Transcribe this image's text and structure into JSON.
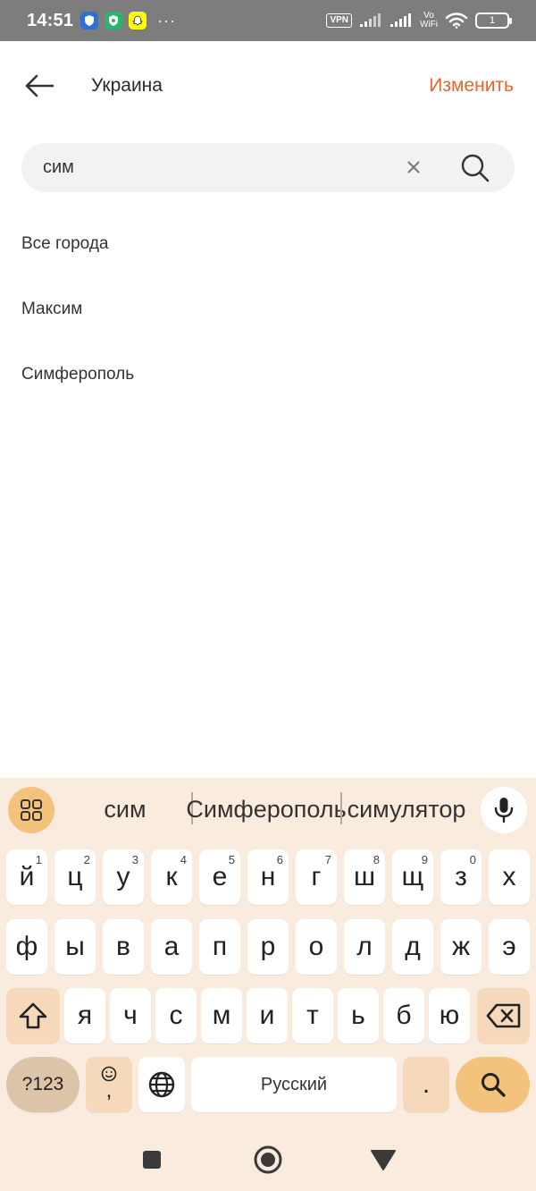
{
  "status_bar": {
    "time": "14:51",
    "more": "···",
    "vpn": "VPN",
    "vo": "Vo",
    "wifi_label": "WiFi",
    "battery": "1"
  },
  "header": {
    "title": "Украина",
    "action": "Изменить"
  },
  "search": {
    "value": "сим"
  },
  "results": [
    {
      "label": "Все города"
    },
    {
      "label": "Максим"
    },
    {
      "label": "Симферополь"
    }
  ],
  "keyboard": {
    "suggestions": [
      "сим",
      "Симферополь",
      "симулятор"
    ],
    "row1": [
      {
        "char": "й",
        "hint": "1"
      },
      {
        "char": "ц",
        "hint": "2"
      },
      {
        "char": "у",
        "hint": "3"
      },
      {
        "char": "к",
        "hint": "4"
      },
      {
        "char": "е",
        "hint": "5"
      },
      {
        "char": "н",
        "hint": "6"
      },
      {
        "char": "г",
        "hint": "7"
      },
      {
        "char": "ш",
        "hint": "8"
      },
      {
        "char": "щ",
        "hint": "9"
      },
      {
        "char": "з",
        "hint": "0"
      },
      {
        "char": "х",
        "hint": ""
      }
    ],
    "row2": [
      "ф",
      "ы",
      "в",
      "а",
      "п",
      "р",
      "о",
      "л",
      "д",
      "ж",
      "э"
    ],
    "row3": [
      "я",
      "ч",
      "с",
      "м",
      "и",
      "т",
      "ь",
      "б",
      "ю"
    ],
    "symbols_label": "?123",
    "emoji_comma": ",",
    "space_label": "Русский",
    "period": "."
  },
  "colors": {
    "accent": "#e8662b",
    "keyboard_bg": "#faebdf",
    "function_key": "#f6d9bb",
    "action_key": "#f3c27d",
    "status_bar": "#7d7d7d"
  },
  "icons": {
    "back": "arrow-left-icon",
    "clear": "close-icon",
    "search": "search-icon",
    "menu": "grid-icon",
    "mic": "microphone-icon",
    "shift": "shift-icon",
    "backspace": "backspace-icon",
    "globe": "globe-icon",
    "enter": "search-icon",
    "nav_recents": "square-icon",
    "nav_home": "circle-icon",
    "nav_back": "triangle-icon"
  }
}
